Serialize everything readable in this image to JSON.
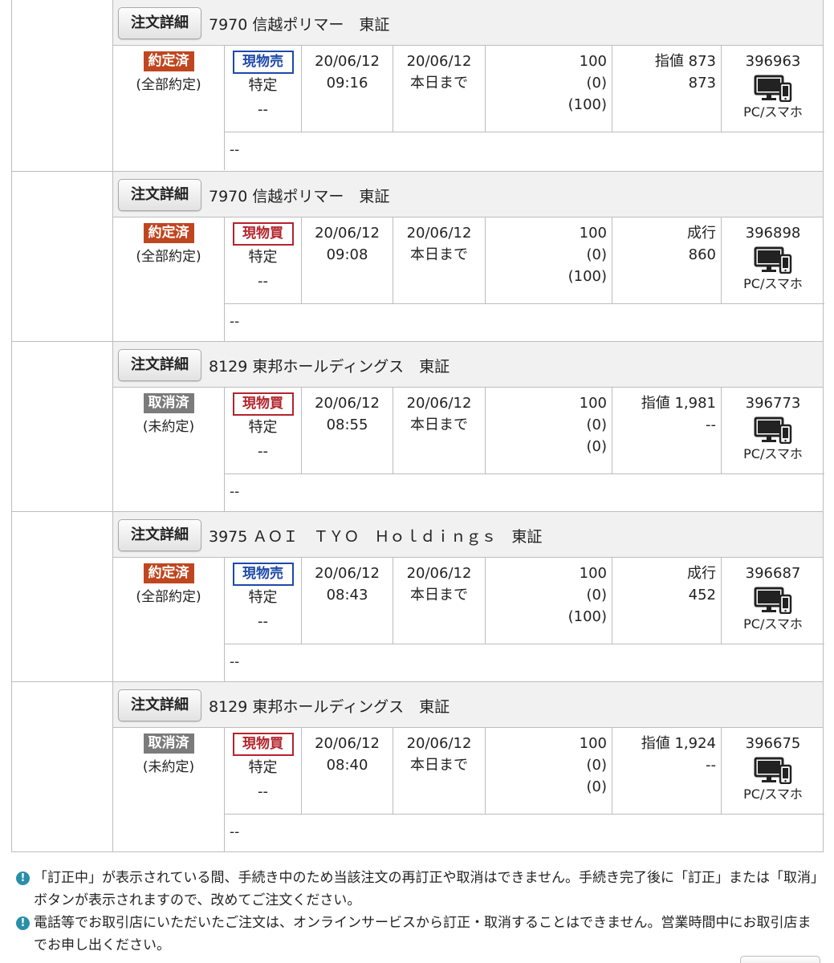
{
  "colors": {
    "filled": "#c0461f",
    "cancelled": "#7b7b7b",
    "sell": "#1e49a8",
    "buy": "#b3242c",
    "info": "#2a8fa8"
  },
  "orders": [
    {
      "detail_button": "注文詳細",
      "stock": "7970 信越ポリマー　東証",
      "status": "約定済",
      "status_type": "filled",
      "status_sub": "(全部約定)",
      "trade": "現物売",
      "trade_type": "sell",
      "account": "特定",
      "account_sub": "--",
      "order_date": "20/06/12",
      "order_time": "09:16",
      "expiry_date": "20/06/12",
      "expiry_label": "本日まで",
      "qty": "100",
      "qty_pending": "(0)",
      "qty_filled": "(100)",
      "price_condition": "指値 873",
      "price_filled": "873",
      "order_no": "396963",
      "channel_icon": "pc-smartphone-icon",
      "channel": "PC/スマホ",
      "memo": "--"
    },
    {
      "detail_button": "注文詳細",
      "stock": "7970 信越ポリマー　東証",
      "status": "約定済",
      "status_type": "filled",
      "status_sub": "(全部約定)",
      "trade": "現物買",
      "trade_type": "buy",
      "account": "特定",
      "account_sub": "--",
      "order_date": "20/06/12",
      "order_time": "09:08",
      "expiry_date": "20/06/12",
      "expiry_label": "本日まで",
      "qty": "100",
      "qty_pending": "(0)",
      "qty_filled": "(100)",
      "price_condition": "成行",
      "price_filled": "860",
      "order_no": "396898",
      "channel_icon": "pc-smartphone-icon",
      "channel": "PC/スマホ",
      "memo": "--"
    },
    {
      "detail_button": "注文詳細",
      "stock": "8129 東邦ホールディングス　東証",
      "status": "取消済",
      "status_type": "cancelled",
      "status_sub": "(未約定)",
      "trade": "現物買",
      "trade_type": "buy",
      "account": "特定",
      "account_sub": "--",
      "order_date": "20/06/12",
      "order_time": "08:55",
      "expiry_date": "20/06/12",
      "expiry_label": "本日まで",
      "qty": "100",
      "qty_pending": "(0)",
      "qty_filled": "(0)",
      "price_condition": "指値 1,981",
      "price_filled": "--",
      "order_no": "396773",
      "channel_icon": "pc-smartphone-icon",
      "channel": "PC/スマホ",
      "memo": "--"
    },
    {
      "detail_button": "注文詳細",
      "stock": "3975 ＡＯＩ　ＴＹＯ　Ｈｏｌｄｉｎｇｓ　東証",
      "status": "約定済",
      "status_type": "filled",
      "status_sub": "(全部約定)",
      "trade": "現物売",
      "trade_type": "sell",
      "account": "特定",
      "account_sub": "--",
      "order_date": "20/06/12",
      "order_time": "08:43",
      "expiry_date": "20/06/12",
      "expiry_label": "本日まで",
      "qty": "100",
      "qty_pending": "(0)",
      "qty_filled": "(100)",
      "price_condition": "成行",
      "price_filled": "452",
      "order_no": "396687",
      "channel_icon": "pc-smartphone-icon",
      "channel": "PC/スマホ",
      "memo": "--"
    },
    {
      "detail_button": "注文詳細",
      "stock": "8129 東邦ホールディングス　東証",
      "status": "取消済",
      "status_type": "cancelled",
      "status_sub": "(未約定)",
      "trade": "現物買",
      "trade_type": "buy",
      "account": "特定",
      "account_sub": "--",
      "order_date": "20/06/12",
      "order_time": "08:40",
      "expiry_date": "20/06/12",
      "expiry_label": "本日まで",
      "qty": "100",
      "qty_pending": "(0)",
      "qty_filled": "(0)",
      "price_condition": "指値 1,924",
      "price_filled": "--",
      "order_no": "396675",
      "channel_icon": "pc-smartphone-icon",
      "channel": "PC/スマホ",
      "memo": "--"
    }
  ],
  "notes": [
    {
      "icon": "info-icon",
      "text": "「訂正中」が表示されている間、手続き中のため当該注文の再訂正や取消はできません。手続き完了後に「訂正」または「取消」ボタンが表示されますので、改めてご注文ください。"
    },
    {
      "icon": "info-icon",
      "text": "電話等でお取引店にいただいたご注文は、オンラインサービスから訂正・取消することはできません。営業時間中にお取引店までお申し出ください。"
    }
  ]
}
